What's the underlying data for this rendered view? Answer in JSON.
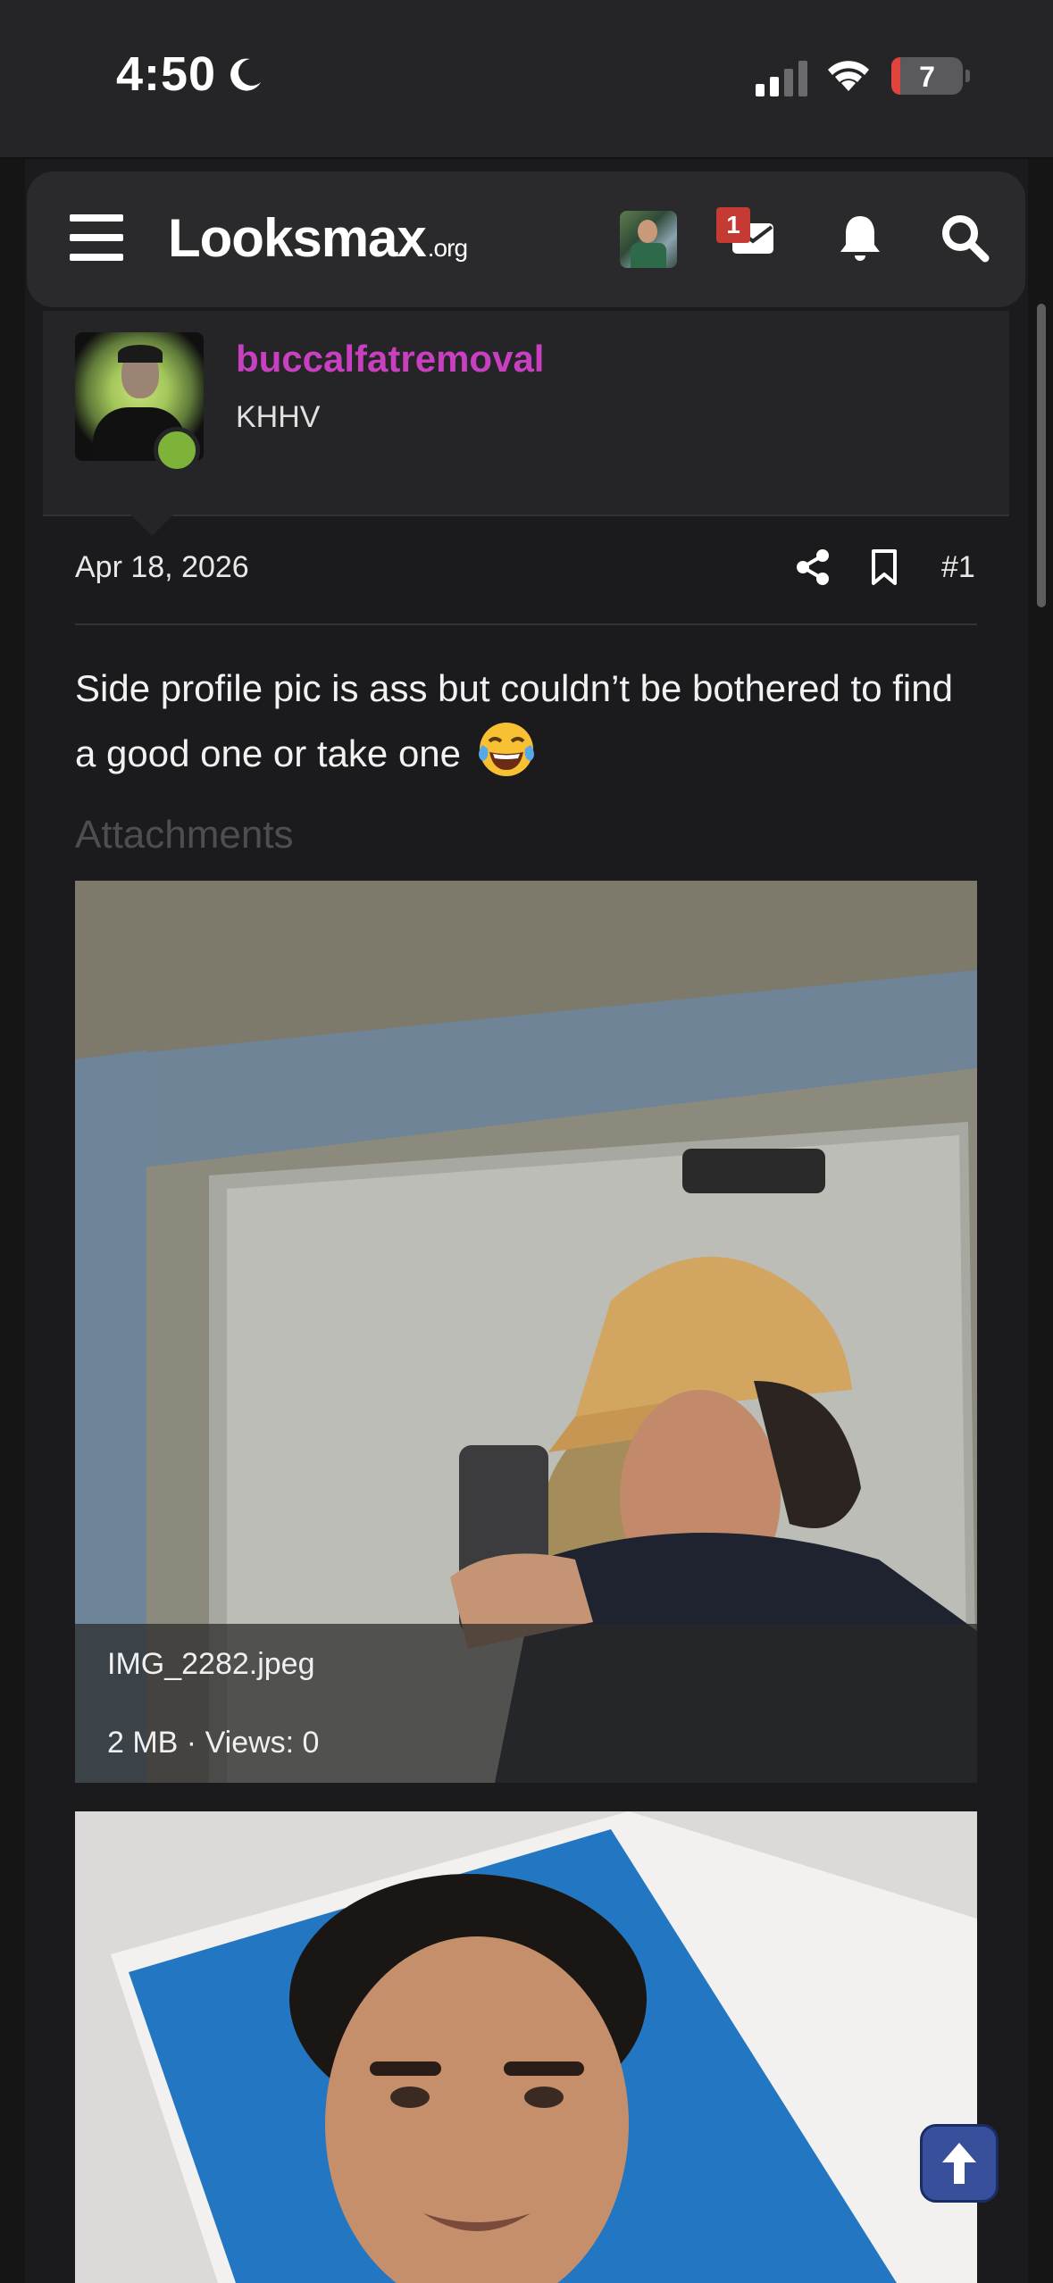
{
  "status_bar": {
    "time": "4:50",
    "battery": "7",
    "battery_color": "#e0443c"
  },
  "nav": {
    "logo_main": "Looksmax",
    "logo_suffix": ".org",
    "messages_badge": "1",
    "icons": [
      "menu-icon",
      "avatar",
      "mail-icon",
      "bell-icon",
      "search-icon"
    ]
  },
  "post": {
    "username": "buccalfatremoval",
    "username_color": "#c83fc0",
    "user_title": "KHHV",
    "online_color": "#7eb33a",
    "date": "Apr 18, 2026",
    "post_number": "#1",
    "body": "Side profile pic is ass but couldn’t be bothered to find a good one or take one",
    "emoji": "face-with-tears-of-joy"
  },
  "attachments": {
    "heading": "Attachments",
    "items": [
      {
        "name": "IMG_2282.jpeg",
        "meta": "2 MB · Views: 0"
      }
    ]
  }
}
